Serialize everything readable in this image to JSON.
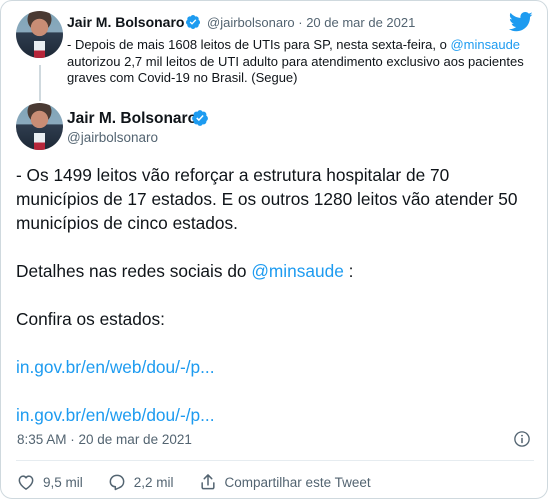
{
  "quoted": {
    "name": "Jair M. Bolsonaro",
    "handle": "@jairbolsonaro",
    "sep": " · ",
    "date": "20 de mar de 2021",
    "text_part1": "- Depois de mais 1608 leitos de UTIs para SP, nesta sexta-feira, o ",
    "mention": "@minsaude",
    "text_part2": " autorizou 2,7 mil leitos de UTI adulto para atendimento exclusivo aos pacientes graves com Covid-19 no Brasil. (Segue)"
  },
  "tweet": {
    "name": "Jair M. Bolsonaro",
    "handle": "@jairbolsonaro",
    "para1": "- Os 1499 leitos vão reforçar a estrutura hospitalar de 70 municípios de 17 estados. E os outros 1280 leitos vão atender 50 municípios de cinco estados.",
    "para2_prefix": "Detalhes nas redes sociais do ",
    "para2_mention": "@minsaude",
    "para2_suffix": " :",
    "para3": "Confira os estados:",
    "link1": "in.gov.br/en/web/dou/-/p...",
    "link2": "in.gov.br/en/web/dou/-/p...",
    "timestamp": "8:35 AM · 20 de mar de 2021"
  },
  "actions": {
    "likes": "9,5 mil",
    "replies": "2,2 mil",
    "share": "Compartilhar este Tweet"
  },
  "icons": {
    "brand": "twitter-bird-icon",
    "verified": "verified-badge-icon",
    "info": "info-icon",
    "like": "heart-icon",
    "reply": "comment-icon",
    "share": "share-icon"
  },
  "colors": {
    "accent": "#1d9bf0",
    "text": "#0f1419",
    "muted": "#536471",
    "border": "#cfd9de"
  }
}
